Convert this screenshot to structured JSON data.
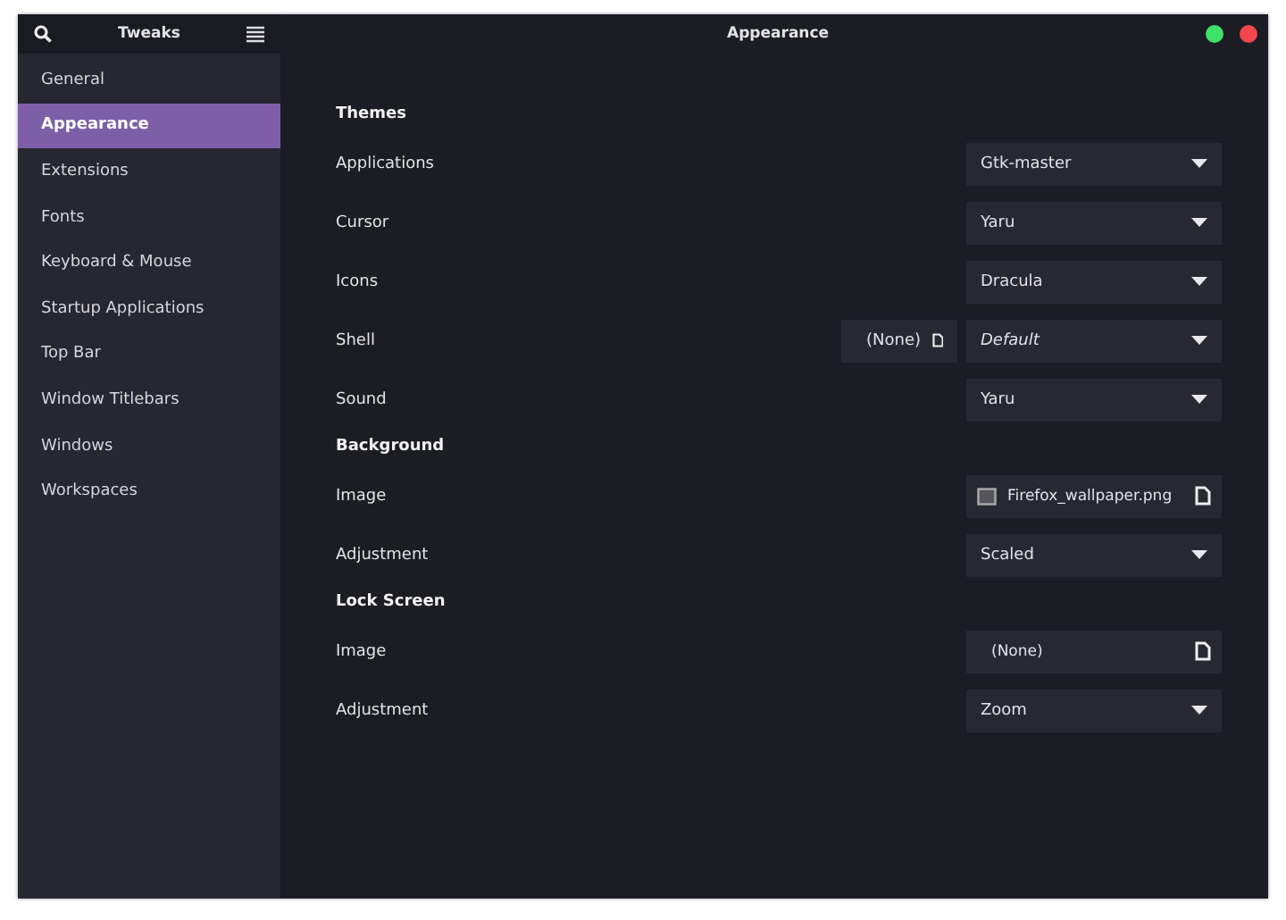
{
  "sidebar": {
    "title": "Tweaks",
    "items": [
      {
        "label": "General",
        "selected": false
      },
      {
        "label": "Appearance",
        "selected": true
      },
      {
        "label": "Extensions",
        "selected": false
      },
      {
        "label": "Fonts",
        "selected": false
      },
      {
        "label": "Keyboard & Mouse",
        "selected": false
      },
      {
        "label": "Startup Applications",
        "selected": false
      },
      {
        "label": "Top Bar",
        "selected": false
      },
      {
        "label": "Window Titlebars",
        "selected": false
      },
      {
        "label": "Windows",
        "selected": false
      },
      {
        "label": "Workspaces",
        "selected": false
      }
    ]
  },
  "window": {
    "title": "Appearance",
    "controls": [
      {
        "color": "#3ee06a"
      },
      {
        "color": "#f2474f"
      }
    ]
  },
  "sections": [
    {
      "title": "Themes",
      "rows": [
        {
          "label": "Applications",
          "kind": "dropdown",
          "value": "Gtk-master"
        },
        {
          "label": "Cursor",
          "kind": "dropdown",
          "value": "Yaru"
        },
        {
          "label": "Icons",
          "kind": "dropdown",
          "value": "Dracula"
        },
        {
          "label": "Shell",
          "kind": "file_dropdown",
          "file": "(None)",
          "value": "Default",
          "italic": true
        },
        {
          "label": "Sound",
          "kind": "dropdown",
          "value": "Yaru"
        }
      ]
    },
    {
      "title": "Background",
      "rows": [
        {
          "label": "Image",
          "kind": "file",
          "value": "Firefox_wallpaper.png",
          "preview": true
        },
        {
          "label": "Adjustment",
          "kind": "dropdown",
          "value": "Scaled"
        }
      ]
    },
    {
      "title": "Lock Screen",
      "rows": [
        {
          "label": "Image",
          "kind": "file",
          "value": "(None)",
          "preview": false
        },
        {
          "label": "Adjustment",
          "kind": "dropdown",
          "value": "Zoom"
        }
      ]
    }
  ]
}
